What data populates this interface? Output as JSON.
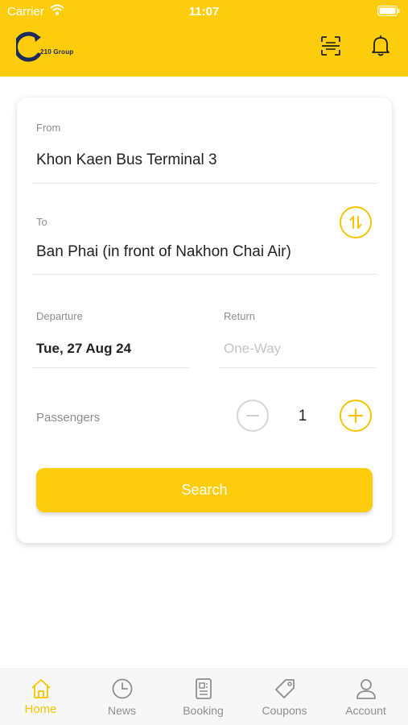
{
  "status_bar": {
    "carrier": "Carrier",
    "time": "11:07"
  },
  "header": {
    "logo_text": "210 Group",
    "brand_color": "#fccc0d",
    "logo_color": "#1d2a5c",
    "icons": [
      "scan-icon",
      "bell-icon"
    ]
  },
  "form": {
    "from": {
      "label": "From",
      "value": "Khon Kaen Bus Terminal 3"
    },
    "to": {
      "label": "To",
      "value": "Ban Phai (in front of Nakhon Chai Air)"
    },
    "departure": {
      "label": "Departure",
      "value": "Tue, 27 Aug 24"
    },
    "return": {
      "label": "Return",
      "placeholder": "One-Way"
    },
    "passengers": {
      "label": "Passengers",
      "value": "1"
    },
    "search_label": "Search"
  },
  "tab_bar": {
    "active_color": "#f5c400",
    "items": [
      {
        "label": "Home",
        "icon": "home-icon",
        "active": true
      },
      {
        "label": "News",
        "icon": "clock-icon",
        "active": false
      },
      {
        "label": "Booking",
        "icon": "document-icon",
        "active": false
      },
      {
        "label": "Coupons",
        "icon": "tag-icon",
        "active": false
      },
      {
        "label": "Account",
        "icon": "user-icon",
        "active": false
      }
    ]
  }
}
